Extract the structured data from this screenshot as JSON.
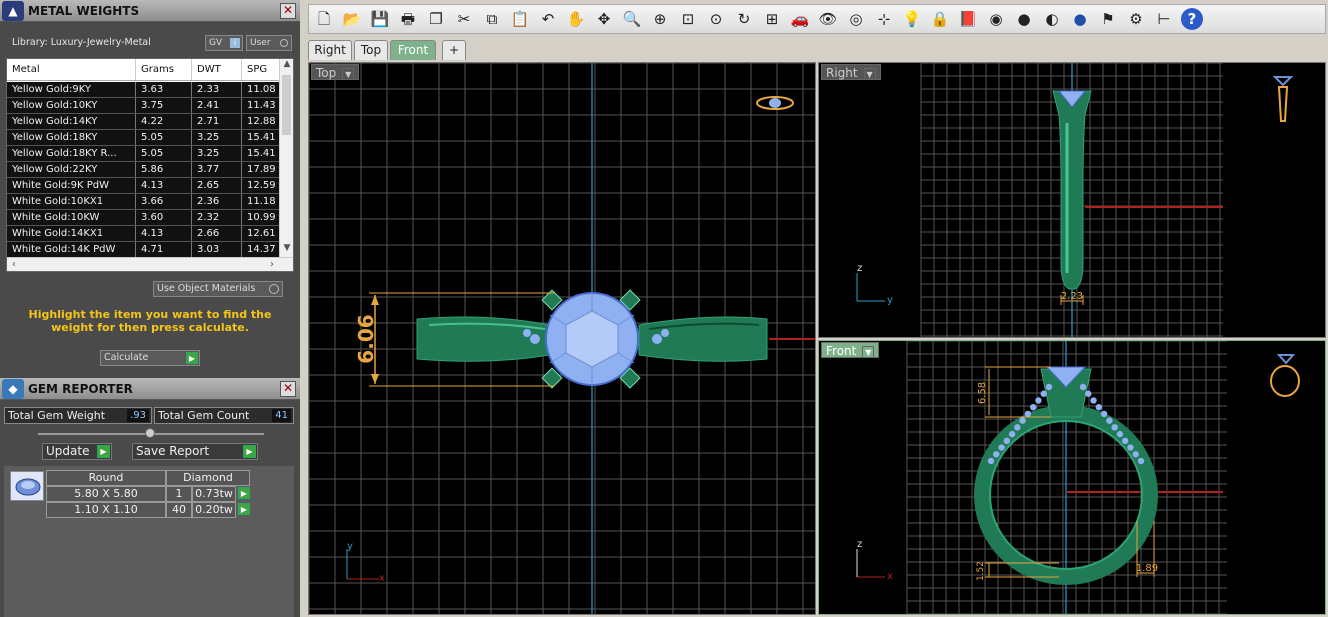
{
  "metal_weights": {
    "title": "METAL WEIGHTS",
    "library": "Library: Luxury-Jewelry-Metal",
    "gv_label": "GV",
    "user_label": "User",
    "columns": [
      "Metal",
      "Grams",
      "DWT",
      "SPG"
    ],
    "rows": [
      [
        "Yellow Gold:9KY",
        "3.63",
        "2.33",
        "11.08"
      ],
      [
        "Yellow Gold:10KY",
        "3.75",
        "2.41",
        "11.43"
      ],
      [
        "Yellow Gold:14KY",
        "4.22",
        "2.71",
        "12.88"
      ],
      [
        "Yellow Gold:18KY",
        "5.05",
        "3.25",
        "15.41"
      ],
      [
        "Yellow Gold:18KY R...",
        "5.05",
        "3.25",
        "15.41"
      ],
      [
        "Yellow Gold:22KY",
        "5.86",
        "3.77",
        "17.89"
      ],
      [
        "White Gold:9K PdW",
        "4.13",
        "2.65",
        "12.59"
      ],
      [
        "White Gold:10KX1",
        "3.66",
        "2.36",
        "11.18"
      ],
      [
        "White Gold:10KW",
        "3.60",
        "2.32",
        "10.99"
      ],
      [
        "White Gold:14KX1",
        "4.13",
        "2.66",
        "12.61"
      ],
      [
        "White Gold:14K PdW",
        "4.71",
        "3.03",
        "14.37"
      ]
    ],
    "use_object_materials": "Use Object Materials",
    "hint": "Highlight the item you want to find the weight for then press calculate.",
    "calculate_label": "Calculate"
  },
  "gem_reporter": {
    "title": "GEM REPORTER",
    "total_weight_label": "Total Gem Weight",
    "total_weight_value": ".93",
    "total_count_label": "Total Gem Count",
    "total_count_value": "41",
    "update_label": "Update",
    "save_report_label": "Save Report",
    "shape": "Round",
    "material": "Diamond",
    "gems": [
      {
        "size": "5.80 X 5.80",
        "count": "1",
        "weight": "0.73tw"
      },
      {
        "size": "1.10 X 1.10",
        "count": "40",
        "weight": "0.20tw"
      }
    ]
  },
  "toolbar": {
    "icons": [
      "new-file-icon",
      "open-folder-icon",
      "save-icon",
      "print-icon",
      "copy-view-icon",
      "cut-icon",
      "copy-icon",
      "paste-icon",
      "undo-icon",
      "pan-hand-icon",
      "move-icon",
      "zoom-icon",
      "zoom-window-icon",
      "zoom-extents-icon",
      "zoom-selected-icon",
      "rotate-view-icon",
      "four-views-icon",
      "car-icon",
      "eye-icon",
      "target-icon",
      "snap-icon",
      "light-bulb-icon",
      "lock-icon",
      "layers-icon",
      "color-wheel-icon",
      "render-sphere-icon",
      "shaded-sphere-icon",
      "blue-sphere-icon",
      "flag-icon",
      "settings-gear-icon",
      "dimension-icon",
      "help-icon"
    ],
    "glyphs": [
      "🗋",
      "📂",
      "💾",
      "🖶",
      "❐",
      "✂",
      "⧉",
      "📋",
      "↶",
      "✋",
      "✥",
      "🔍",
      "⊕",
      "⊡",
      "⊙",
      "↻",
      "⊞",
      "🚗",
      "👁",
      "◎",
      "⊹",
      "💡",
      "🔒",
      "📕",
      "◉",
      "●",
      "◐",
      "●",
      "⚑",
      "⚙",
      "⊢",
      "?"
    ]
  },
  "view_tabs": [
    "Right",
    "Top",
    "Front",
    "+"
  ],
  "active_tab": "Front",
  "viewports": {
    "top": {
      "label": "Top",
      "dimension": "6.06",
      "axis_x": "x",
      "axis_y": "y"
    },
    "right": {
      "label": "Right",
      "dimension": "2.23",
      "axis_z": "z",
      "axis_y": "y"
    },
    "front": {
      "label": "Front",
      "dim_height": "6.58",
      "dim_bottom": "1.52",
      "dim_width": "1.89",
      "axis_z": "z",
      "axis_x": "x"
    }
  },
  "colors": {
    "metal_green": "#1f7a55",
    "gem_blue": "#8fb1f2",
    "dimension_orange": "#e8a640",
    "grid": "#555555",
    "axis_blue": "#2aa0c8",
    "axis_red": "#b02020"
  }
}
